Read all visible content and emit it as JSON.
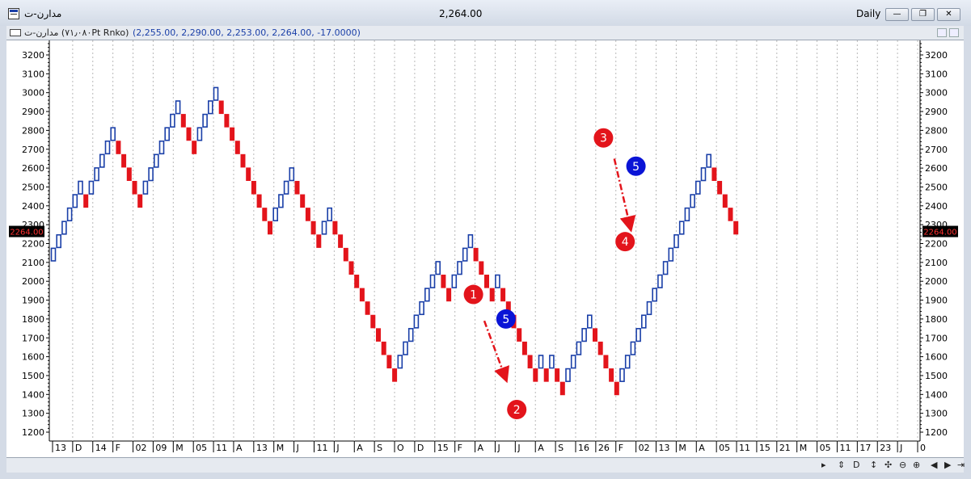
{
  "window": {
    "title": "مدارن-ت",
    "last_price": "2,264.00",
    "period": "Daily",
    "buttons": {
      "minimize_glyph": "—",
      "restore_glyph": "❐",
      "close_glyph": "✕"
    }
  },
  "subheader": {
    "series_name": "مدارن-ت (۷۱٫۰۸۰Pt Rnko)",
    "values": "(2,255.00, 2,290.00, 2,253.00, 2,264.00, -17.0000)"
  },
  "colors": {
    "up": "#1a3fa8",
    "down": "#e3141b",
    "annotation_red": "#e3141b",
    "annotation_blue": "#0a14d6",
    "grid": "#b8b8b8"
  },
  "chart_data": {
    "type": "renko",
    "box_size": 71.08,
    "ylim": [
      1160,
      3280
    ],
    "yticks": [
      1200,
      1300,
      1400,
      1500,
      1600,
      1700,
      1800,
      1900,
      2000,
      2100,
      2200,
      2300,
      2400,
      2500,
      2600,
      2700,
      2800,
      2900,
      3000,
      3100,
      3200
    ],
    "last_value": 2264,
    "last_value_label": "2264.00",
    "time_axis_labels": [
      "13",
      "D",
      "14",
      "F",
      "02",
      "09",
      "M",
      "05",
      "11",
      "A",
      "13",
      "M",
      "J",
      "11",
      "J",
      "A",
      "S",
      "O",
      "D",
      "15",
      "F",
      "A",
      "J",
      "J",
      "A",
      "S",
      "16",
      "26",
      "F",
      "02",
      "13",
      "M",
      "A",
      "05",
      "11",
      "15",
      "21",
      "M",
      "05",
      "11",
      "17",
      "23",
      "J",
      "0"
    ],
    "bricks": [
      {
        "d": "u",
        "lo": 2106,
        "hi": 2177
      },
      {
        "d": "u",
        "lo": 2177,
        "hi": 2248
      },
      {
        "d": "u",
        "lo": 2248,
        "hi": 2319
      },
      {
        "d": "u",
        "lo": 2319,
        "hi": 2390
      },
      {
        "d": "u",
        "lo": 2390,
        "hi": 2461
      },
      {
        "d": "u",
        "lo": 2461,
        "hi": 2532
      },
      {
        "d": "d",
        "lo": 2390,
        "hi": 2461
      },
      {
        "d": "u",
        "lo": 2461,
        "hi": 2532
      },
      {
        "d": "u",
        "lo": 2532,
        "hi": 2603
      },
      {
        "d": "u",
        "lo": 2603,
        "hi": 2674
      },
      {
        "d": "u",
        "lo": 2674,
        "hi": 2745
      },
      {
        "d": "u",
        "lo": 2745,
        "hi": 2816
      },
      {
        "d": "d",
        "lo": 2674,
        "hi": 2745
      },
      {
        "d": "d",
        "lo": 2603,
        "hi": 2674
      },
      {
        "d": "d",
        "lo": 2532,
        "hi": 2603
      },
      {
        "d": "d",
        "lo": 2461,
        "hi": 2532
      },
      {
        "d": "d",
        "lo": 2390,
        "hi": 2461
      },
      {
        "d": "u",
        "lo": 2461,
        "hi": 2532
      },
      {
        "d": "u",
        "lo": 2532,
        "hi": 2603
      },
      {
        "d": "u",
        "lo": 2603,
        "hi": 2674
      },
      {
        "d": "u",
        "lo": 2674,
        "hi": 2745
      },
      {
        "d": "u",
        "lo": 2745,
        "hi": 2816
      },
      {
        "d": "u",
        "lo": 2816,
        "hi": 2887
      },
      {
        "d": "u",
        "lo": 2887,
        "hi": 2958
      },
      {
        "d": "d",
        "lo": 2816,
        "hi": 2887
      },
      {
        "d": "d",
        "lo": 2745,
        "hi": 2816
      },
      {
        "d": "d",
        "lo": 2674,
        "hi": 2745
      },
      {
        "d": "u",
        "lo": 2745,
        "hi": 2816
      },
      {
        "d": "u",
        "lo": 2816,
        "hi": 2887
      },
      {
        "d": "u",
        "lo": 2887,
        "hi": 2958
      },
      {
        "d": "u",
        "lo": 2958,
        "hi": 3029
      },
      {
        "d": "d",
        "lo": 2887,
        "hi": 2958
      },
      {
        "d": "d",
        "lo": 2816,
        "hi": 2887
      },
      {
        "d": "d",
        "lo": 2745,
        "hi": 2816
      },
      {
        "d": "d",
        "lo": 2674,
        "hi": 2745
      },
      {
        "d": "d",
        "lo": 2603,
        "hi": 2674
      },
      {
        "d": "d",
        "lo": 2532,
        "hi": 2603
      },
      {
        "d": "d",
        "lo": 2461,
        "hi": 2532
      },
      {
        "d": "d",
        "lo": 2390,
        "hi": 2461
      },
      {
        "d": "d",
        "lo": 2319,
        "hi": 2390
      },
      {
        "d": "d",
        "lo": 2248,
        "hi": 2319
      },
      {
        "d": "u",
        "lo": 2319,
        "hi": 2390
      },
      {
        "d": "u",
        "lo": 2390,
        "hi": 2461
      },
      {
        "d": "u",
        "lo": 2461,
        "hi": 2532
      },
      {
        "d": "u",
        "lo": 2532,
        "hi": 2603
      },
      {
        "d": "d",
        "lo": 2461,
        "hi": 2532
      },
      {
        "d": "d",
        "lo": 2390,
        "hi": 2461
      },
      {
        "d": "d",
        "lo": 2319,
        "hi": 2390
      },
      {
        "d": "d",
        "lo": 2248,
        "hi": 2319
      },
      {
        "d": "d",
        "lo": 2177,
        "hi": 2248
      },
      {
        "d": "u",
        "lo": 2248,
        "hi": 2319
      },
      {
        "d": "u",
        "lo": 2319,
        "hi": 2390
      },
      {
        "d": "d",
        "lo": 2248,
        "hi": 2319
      },
      {
        "d": "d",
        "lo": 2177,
        "hi": 2248
      },
      {
        "d": "d",
        "lo": 2106,
        "hi": 2177
      },
      {
        "d": "d",
        "lo": 2035,
        "hi": 2106
      },
      {
        "d": "d",
        "lo": 1964,
        "hi": 2035
      },
      {
        "d": "d",
        "lo": 1893,
        "hi": 1964
      },
      {
        "d": "d",
        "lo": 1822,
        "hi": 1893
      },
      {
        "d": "d",
        "lo": 1751,
        "hi": 1822
      },
      {
        "d": "d",
        "lo": 1680,
        "hi": 1751
      },
      {
        "d": "d",
        "lo": 1609,
        "hi": 1680
      },
      {
        "d": "d",
        "lo": 1538,
        "hi": 1609
      },
      {
        "d": "d",
        "lo": 1467,
        "hi": 1538
      },
      {
        "d": "u",
        "lo": 1538,
        "hi": 1609
      },
      {
        "d": "u",
        "lo": 1609,
        "hi": 1680
      },
      {
        "d": "u",
        "lo": 1680,
        "hi": 1751
      },
      {
        "d": "u",
        "lo": 1751,
        "hi": 1822
      },
      {
        "d": "u",
        "lo": 1822,
        "hi": 1893
      },
      {
        "d": "u",
        "lo": 1893,
        "hi": 1964
      },
      {
        "d": "u",
        "lo": 1964,
        "hi": 2035
      },
      {
        "d": "u",
        "lo": 2035,
        "hi": 2106
      },
      {
        "d": "d",
        "lo": 1964,
        "hi": 2035
      },
      {
        "d": "d",
        "lo": 1893,
        "hi": 1964
      },
      {
        "d": "u",
        "lo": 1964,
        "hi": 2035
      },
      {
        "d": "u",
        "lo": 2035,
        "hi": 2106
      },
      {
        "d": "u",
        "lo": 2106,
        "hi": 2177
      },
      {
        "d": "u",
        "lo": 2177,
        "hi": 2248
      },
      {
        "d": "d",
        "lo": 2106,
        "hi": 2177
      },
      {
        "d": "d",
        "lo": 2035,
        "hi": 2106
      },
      {
        "d": "d",
        "lo": 1964,
        "hi": 2035
      },
      {
        "d": "d",
        "lo": 1893,
        "hi": 1964
      },
      {
        "d": "u",
        "lo": 1964,
        "hi": 2035
      },
      {
        "d": "d",
        "lo": 1893,
        "hi": 1964
      },
      {
        "d": "d",
        "lo": 1822,
        "hi": 1893
      },
      {
        "d": "d",
        "lo": 1751,
        "hi": 1822
      },
      {
        "d": "d",
        "lo": 1680,
        "hi": 1751
      },
      {
        "d": "d",
        "lo": 1609,
        "hi": 1680
      },
      {
        "d": "d",
        "lo": 1538,
        "hi": 1609
      },
      {
        "d": "d",
        "lo": 1467,
        "hi": 1538
      },
      {
        "d": "u",
        "lo": 1538,
        "hi": 1609
      },
      {
        "d": "d",
        "lo": 1467,
        "hi": 1538
      },
      {
        "d": "u",
        "lo": 1538,
        "hi": 1609
      },
      {
        "d": "d",
        "lo": 1467,
        "hi": 1538
      },
      {
        "d": "d",
        "lo": 1396,
        "hi": 1467
      },
      {
        "d": "u",
        "lo": 1467,
        "hi": 1538
      },
      {
        "d": "u",
        "lo": 1538,
        "hi": 1609
      },
      {
        "d": "u",
        "lo": 1609,
        "hi": 1680
      },
      {
        "d": "u",
        "lo": 1680,
        "hi": 1751
      },
      {
        "d": "u",
        "lo": 1751,
        "hi": 1822
      },
      {
        "d": "d",
        "lo": 1680,
        "hi": 1751
      },
      {
        "d": "d",
        "lo": 1609,
        "hi": 1680
      },
      {
        "d": "d",
        "lo": 1538,
        "hi": 1609
      },
      {
        "d": "d",
        "lo": 1467,
        "hi": 1538
      },
      {
        "d": "d",
        "lo": 1396,
        "hi": 1467
      },
      {
        "d": "u",
        "lo": 1467,
        "hi": 1538
      },
      {
        "d": "u",
        "lo": 1538,
        "hi": 1609
      },
      {
        "d": "u",
        "lo": 1609,
        "hi": 1680
      },
      {
        "d": "u",
        "lo": 1680,
        "hi": 1751
      },
      {
        "d": "u",
        "lo": 1751,
        "hi": 1822
      },
      {
        "d": "u",
        "lo": 1822,
        "hi": 1893
      },
      {
        "d": "u",
        "lo": 1893,
        "hi": 1964
      },
      {
        "d": "u",
        "lo": 1964,
        "hi": 2035
      },
      {
        "d": "u",
        "lo": 2035,
        "hi": 2106
      },
      {
        "d": "u",
        "lo": 2106,
        "hi": 2177
      },
      {
        "d": "u",
        "lo": 2177,
        "hi": 2248
      },
      {
        "d": "u",
        "lo": 2248,
        "hi": 2319
      },
      {
        "d": "u",
        "lo": 2319,
        "hi": 2390
      },
      {
        "d": "u",
        "lo": 2390,
        "hi": 2461
      },
      {
        "d": "u",
        "lo": 2461,
        "hi": 2532
      },
      {
        "d": "u",
        "lo": 2532,
        "hi": 2603
      },
      {
        "d": "u",
        "lo": 2603,
        "hi": 2674
      },
      {
        "d": "d",
        "lo": 2532,
        "hi": 2603
      },
      {
        "d": "d",
        "lo": 2461,
        "hi": 2532
      },
      {
        "d": "d",
        "lo": 2390,
        "hi": 2461
      },
      {
        "d": "d",
        "lo": 2319,
        "hi": 2390
      },
      {
        "d": "d",
        "lo": 2248,
        "hi": 2319
      }
    ],
    "annotations": [
      {
        "label": "1",
        "color": "red",
        "brick": 78,
        "value": 1930
      },
      {
        "label": "2",
        "color": "red",
        "brick": 86,
        "value": 1320
      },
      {
        "label": "3",
        "color": "red",
        "brick": 102,
        "value": 2760
      },
      {
        "label": "4",
        "color": "red",
        "brick": 106,
        "value": 2210
      },
      {
        "label": "5",
        "color": "blue",
        "brick": 84,
        "value": 1800
      },
      {
        "label": "5",
        "color": "blue",
        "brick": 108,
        "value": 2610
      }
    ],
    "arrows": [
      {
        "from_brick": 80,
        "from_value": 1790,
        "to_brick": 84,
        "to_value": 1480
      },
      {
        "from_brick": 104,
        "from_value": 2650,
        "to_brick": 107,
        "to_value": 2280
      }
    ]
  },
  "toolbar": {
    "scroll_right_glyph": "▸",
    "tools": [
      "⇕",
      "D",
      "↕",
      "✣",
      "⊖",
      "⊕",
      "◀",
      "▶",
      "⇥"
    ]
  }
}
